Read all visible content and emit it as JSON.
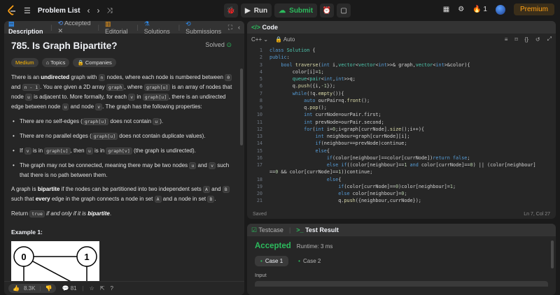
{
  "topbar": {
    "problem_list": "Problem List",
    "run": "Run",
    "submit": "Submit",
    "streak": "1",
    "premium": "Premium"
  },
  "left": {
    "tabs": [
      "Description",
      "Accepted",
      "Editorial",
      "Solutions",
      "Submissions"
    ],
    "title": "785. Is Graph Bipartite?",
    "solved": "Solved",
    "tags": [
      "Medium",
      "Topics",
      "Companies"
    ],
    "example": "Example 1:",
    "likes": "8.3K",
    "comments": "81",
    "graph_nodes": [
      "0",
      "1"
    ]
  },
  "code": {
    "tab": "Code",
    "lang": "C++",
    "auto": "Auto",
    "saved": "Saved",
    "cursor": "Ln 7, Col 27",
    "lines": [
      "class Solution {",
      "public:",
      "    bool traverse(int i,vector<vector<int>>& graph,vector<int>&color){",
      "        color[i]=1;",
      "        queue<pair<int,int>>q;",
      "        q.push({i,-1});",
      "        while(!q.empty()){",
      "            auto ourPair=q.front();",
      "            q.pop();",
      "            int currNode=ourPair.first;",
      "            int prevNode=ourPair.second;",
      "            for(int i=0;i<graph[currNode].size();i++){",
      "                int neighbour=graph[currNode][i];",
      "                if(neighbour==prevNode)continue;",
      "                else{",
      "                    if(color[neighbour]==color[currNode])return false;",
      "                    else if((color[neighbour]==1 and color[currNode]==0) || (color[neighbour]",
      "==0 && color[currNode]==1))continue;",
      "                    else{",
      "                        if(color[currNode]==0)color[neighbour]=1;",
      "                        else color[neighbour]=0;",
      "                        q.push({neighbour,currNode});"
    ],
    "line_numbers": [
      "1",
      "2",
      "3",
      "4",
      "5",
      "6",
      "7",
      "8",
      "9",
      "10",
      "11",
      "12",
      "13",
      "14",
      "15",
      "16",
      "17",
      "",
      "18",
      "19",
      "20",
      "21"
    ]
  },
  "result": {
    "tabs": [
      "Testcase",
      "Test Result"
    ],
    "status": "Accepted",
    "runtime": "Runtime: 3 ms",
    "cases": [
      "Case 1",
      "Case 2"
    ],
    "input_label": "Input"
  }
}
